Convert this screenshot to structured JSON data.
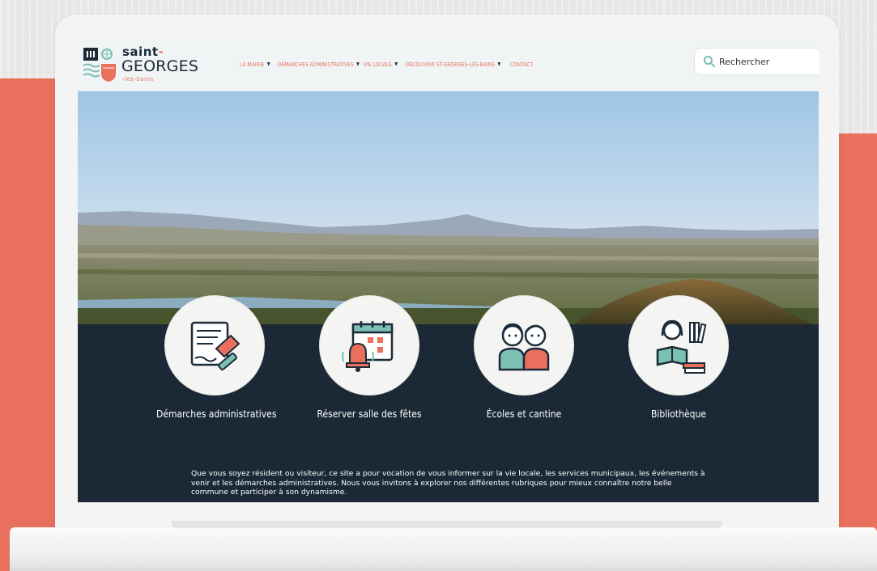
{
  "site": {
    "logo": {
      "line1": "saint",
      "line1_dash": "-",
      "line2": "GEORGES",
      "line3": "-les-bains"
    },
    "nav": [
      {
        "label": "LA MAIRIE",
        "has_dropdown": true
      },
      {
        "label": "DÉMARCHES ADMINISTRATIVES",
        "has_dropdown": true
      },
      {
        "label": "VIE LOCALE",
        "has_dropdown": true
      },
      {
        "label": "DÉCOUVRIR ST-GEORGES-LES-BAINS",
        "has_dropdown": true
      },
      {
        "label": "CONTACT",
        "has_dropdown": false
      }
    ],
    "search": {
      "placeholder": "Rechercher",
      "icon": "search-icon"
    },
    "features": [
      {
        "label": "Démarches administratives",
        "icon": "document-stamp-icon"
      },
      {
        "label": "Réserver salle des fêtes",
        "icon": "calendar-bell-icon"
      },
      {
        "label": "Écoles et cantine",
        "icon": "children-icon"
      },
      {
        "label": "Bibliothèque",
        "icon": "reader-books-icon"
      }
    ],
    "intro": "Que vous soyez résident ou visiteur, ce site a pour vocation de vous informer sur la vie locale, les services municipaux, les événements à venir et les démarches administratives. Nous vous invitons à explorer nos différentes rubriques pour mieux connaître notre belle commune et participer à son dynamisme."
  },
  "colors": {
    "accent": "#e8705d",
    "dark": "#1a2935",
    "teal": "#7cbfb3",
    "header_bg": "#f1f4f4"
  }
}
